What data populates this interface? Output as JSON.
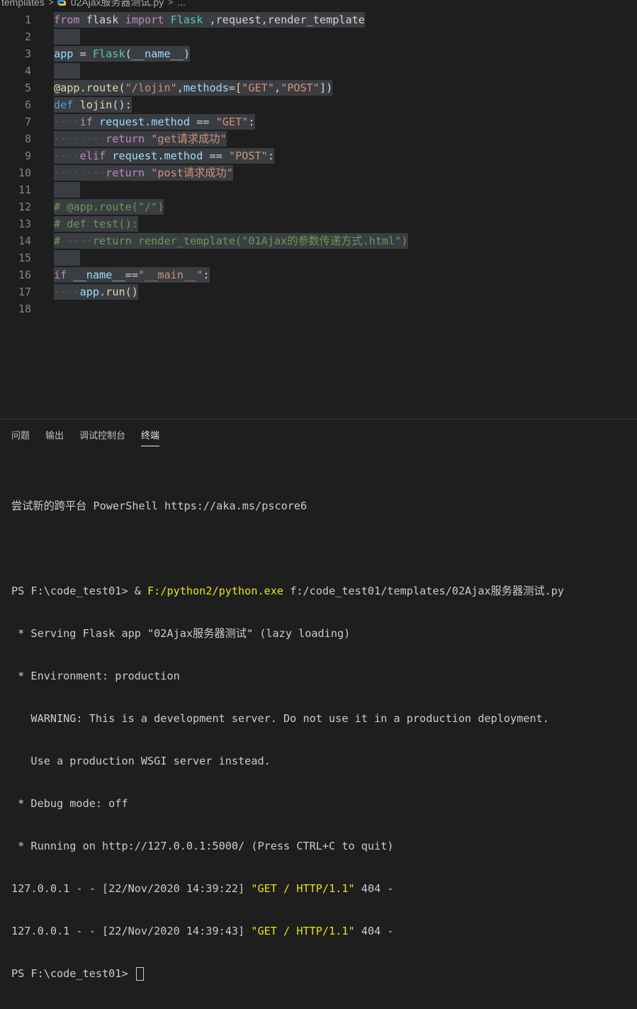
{
  "breadcrumb": {
    "folder": "templates",
    "file": "02Ajax服务器测试.py",
    "more": "..."
  },
  "editor": {
    "lines": [
      {
        "num": "1",
        "text": "from flask import Flask ,request,render_template"
      },
      {
        "num": "2",
        "text": ""
      },
      {
        "num": "3",
        "text": "app = Flask(__name__)"
      },
      {
        "num": "4",
        "text": ""
      },
      {
        "num": "5",
        "text": "@app.route(\"/lojin\",methods=[\"GET\",\"POST\"])"
      },
      {
        "num": "6",
        "text": "def lojin():"
      },
      {
        "num": "7",
        "text": "    if request.method == \"GET\":"
      },
      {
        "num": "8",
        "text": "        return \"get请求成功\""
      },
      {
        "num": "9",
        "text": "    elif request.method == \"POST\":"
      },
      {
        "num": "10",
        "text": "        return \"post请求成功\""
      },
      {
        "num": "11",
        "text": ""
      },
      {
        "num": "12",
        "text": "# @app.route(\"/\")"
      },
      {
        "num": "13",
        "text": "# def test():"
      },
      {
        "num": "14",
        "text": "#     return render_template(\"01Ajax的参数传递方式.html\")"
      },
      {
        "num": "15",
        "text": ""
      },
      {
        "num": "16",
        "text": "if __name__==\"__main__\":"
      },
      {
        "num": "17",
        "text": "    app.run()"
      },
      {
        "num": "18",
        "text": ""
      }
    ]
  },
  "panel": {
    "tabs": [
      "问题",
      "输出",
      "调试控制台",
      "终端"
    ],
    "active_tab": "终端"
  },
  "terminal": {
    "promo": "尝试新的跨平台 PowerShell https://aka.ms/pscore6",
    "prompt1": "PS F:\\code_test01> & ",
    "python_path": "F:/python2/python.exe",
    "script_arg": " f:/code_test01/templates/02Ajax服务器测试.py",
    "out1": " * Serving Flask app \"02Ajax服务器测试\" (lazy loading)",
    "out2": " * Environment: production",
    "out3": "   WARNING: This is a development server. Do not use it in a production deployment.",
    "out4": "   Use a production WSGI server instead.",
    "out5": " * Debug mode: off",
    "out6": " * Running on http://127.0.0.1:5000/ (Press CTRL+C to quit)",
    "req1_prefix": "127.0.0.1 - - [22/Nov/2020 14:39:22] ",
    "req1_quote_open": "\"",
    "req1_request": "GET / HTTP/1.1",
    "req1_quote_close": "\"",
    "req1_suffix": " 404 -",
    "req2_prefix": "127.0.0.1 - - [22/Nov/2020 14:39:43] ",
    "req2_quote_open": "\"",
    "req2_request": "GET / HTTP/1.1",
    "req2_quote_close": "\"",
    "req2_suffix": " 404 -",
    "prompt2": "PS F:\\code_test01> "
  },
  "colors": {
    "background": "#1e1e1e",
    "selection": "#3a3d41",
    "keyword": "#569cd6",
    "control_keyword": "#c586c0",
    "string": "#ce9178",
    "comment": "#6a9955",
    "terminal_highlight": "#e5e510"
  },
  "icons": {
    "file_icon": "python-file-icon"
  }
}
